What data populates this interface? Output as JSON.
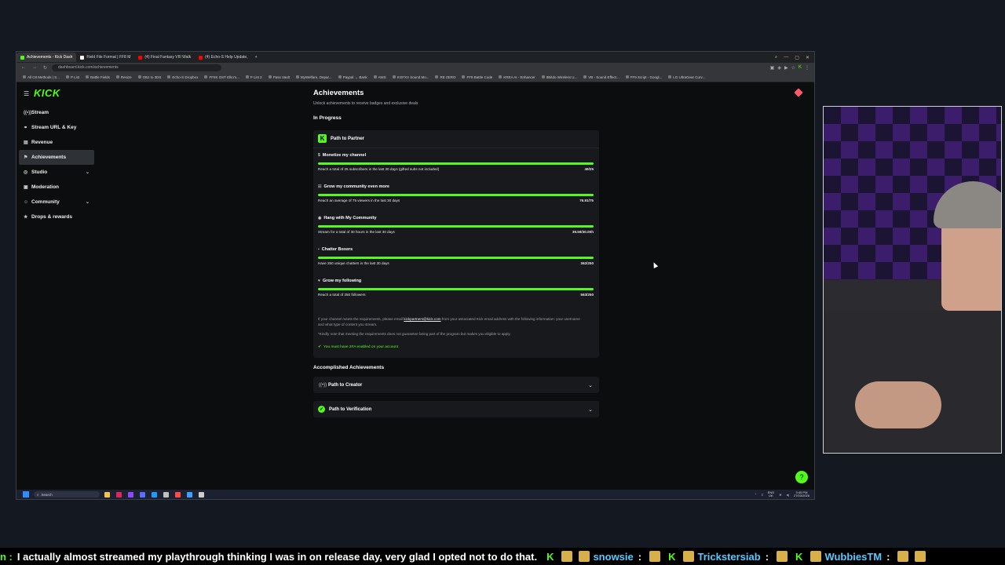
{
  "browser": {
    "tabs": [
      {
        "label": "Achievements - Kick Dash",
        "active": true,
        "color": "#53fc18"
      },
      {
        "label": "Field File Format | FF8 M",
        "active": false,
        "color": "#ffffff"
      },
      {
        "label": "(4) Final Fantasy VIII Walk",
        "active": false,
        "color": "#ff0000"
      },
      {
        "label": "(4) Echo-S Help Update, ",
        "active": false,
        "color": "#ff0000"
      }
    ],
    "new_tab": "+",
    "url": "dashboard.kick.com/achievements",
    "bookmarks": [
      "All C8 Methods | S...",
      "P List",
      "Battle Fields",
      "Resize",
      "OBJ to 3DS",
      "Echo-S Dropbox",
      "FFIIK OST Elko's...",
      "P List 2",
      "Pass Vault",
      "MyWelfare, Depar...",
      "Paypal → Bank",
      "AWS",
      "KOFXV Sound Mo...",
      "RE ZERO",
      "FF8 Battle Code",
      "KREA AI - Enhancer",
      "8Bitdo Wireless U...",
      "VB - Sound Effect...",
      "FF9 Script - Googl...",
      "LG UltraGear Curv..."
    ]
  },
  "sidebar": {
    "logo": "KICK",
    "items": [
      {
        "label": "Stream",
        "icon": "((•))"
      },
      {
        "label": "Stream URL & Key",
        "icon": "⚭"
      },
      {
        "label": "Revenue",
        "icon": "▤"
      },
      {
        "label": "Achievements",
        "icon": "⚑",
        "active": true
      },
      {
        "label": "Studio",
        "icon": "◎",
        "chevron": "⌄"
      },
      {
        "label": "Moderation",
        "icon": "▣"
      },
      {
        "label": "Community",
        "icon": "☺",
        "chevron": "⌄"
      },
      {
        "label": "Drops & rewards",
        "icon": "★"
      }
    ]
  },
  "main": {
    "title": "Achievements",
    "subtitle": "Unlock achievements to receive badges and exclusive deals",
    "in_progress_label": "In Progress",
    "card_title": "Path to Partner",
    "goals": [
      {
        "title": "Monetize my channel",
        "desc": "Reach a total of 25 subscribers in the last 30 days (gifted subs not included)",
        "value": "49/25",
        "progress": 1.0
      },
      {
        "title": "Grow my community even more",
        "desc": "Reach an average of 75 viewers in the last 30 days",
        "value": "76.91/75",
        "progress": 1.0
      },
      {
        "title": "Hang with My Community",
        "desc": "Stream for a total of 30 hours in the last 30 days",
        "value": "39.59/30.00h",
        "progress": 1.0
      },
      {
        "title": "Chatter Boxers",
        "desc": "Have 250 unique chatters in the last 30 days",
        "value": "362/250",
        "progress": 1.0
      },
      {
        "title": "Grow my following",
        "desc": "Reach a total of 250 followers",
        "value": "563/250",
        "progress": 1.0
      }
    ],
    "note_pre": "If your channel meets the requirements, please email",
    "note_email": "kickpartners@kick.com",
    "note_post": "from your associated Kick email address with the following information: your username and what type of content you stream.",
    "note2": "*Kindly note that meeting the requirements does not guarantee being part of the program but makes you eligible to apply.",
    "requirement": "You must have 2FA enabled on your account",
    "accomplished_label": "Accomplished Achievements",
    "accomplished": [
      {
        "label": "Path to Creator"
      },
      {
        "label": "Path to Verification"
      }
    ]
  },
  "taskbar": {
    "search_placeholder": "Search",
    "lang": "ENG",
    "region": "UK",
    "time": "3:45 PM",
    "date": "27/03/2026"
  },
  "ticker": {
    "lead": "n :",
    "message": "I actually almost streamed my playthrough thinking I was in on release day, very glad I opted not to do that.",
    "users": [
      "snowsie",
      "Trickstersiab",
      "WubbiesTM"
    ]
  },
  "colors": {
    "accent": "#53fc18",
    "page_bg": "#0b0d0f",
    "card_bg": "#18191d"
  }
}
